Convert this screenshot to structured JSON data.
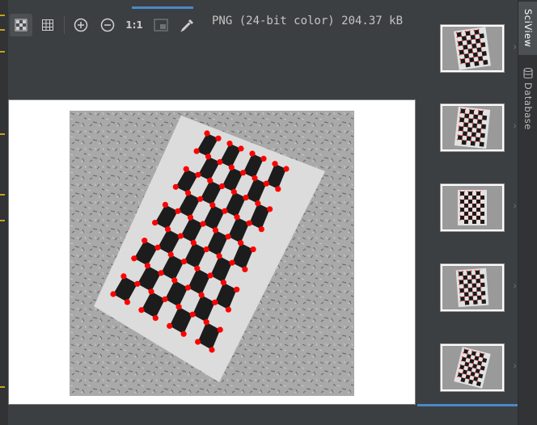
{
  "toolbar": {
    "actual_size_label": "1:1",
    "buttons": [
      {
        "name": "chessboard-icon",
        "active": true
      },
      {
        "name": "grid-icon",
        "active": false
      },
      {
        "name": "zoom-in-icon",
        "active": false
      },
      {
        "name": "zoom-out-icon",
        "active": false
      },
      {
        "name": "fit-icon",
        "active": false
      },
      {
        "name": "color-picker-icon",
        "active": false
      }
    ]
  },
  "image_info": "PNG (24-bit color) 204.37 kB",
  "right_tabs": {
    "sciview": "SciView",
    "database": "Database"
  },
  "thumbnails": [
    {
      "name": "thumbnail-1"
    },
    {
      "name": "thumbnail-2"
    },
    {
      "name": "thumbnail-3"
    },
    {
      "name": "thumbnail-4"
    },
    {
      "name": "thumbnail-5"
    }
  ],
  "colors": {
    "background": "#3c3f41",
    "accent": "#4a88c7",
    "corner_marker": "#ff0000",
    "board_square": "#1c1c1c",
    "board_paper": "#dcdcdc",
    "floor": "#a8a8a8"
  }
}
